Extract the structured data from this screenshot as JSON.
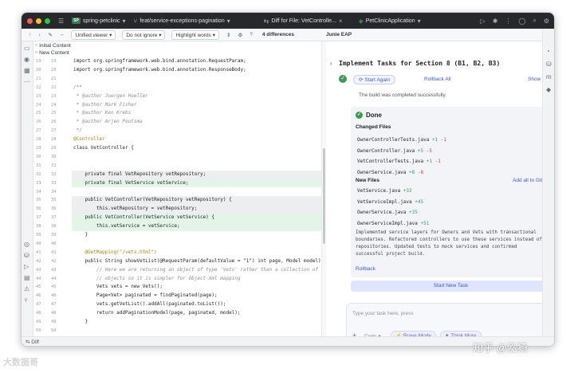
{
  "colors": {
    "titlebar": "#27282c",
    "accent": "#3a5ccc",
    "success": "#3e9b53",
    "diff_added": "#c8ecce",
    "diff_removed": "#edeef0"
  },
  "titlebar": {
    "project": "spring-petclinic",
    "project_badge": "SP",
    "branch": "feat/service-exceptions-pagination",
    "diff_tab": "Diff for File: VetControlle...",
    "run_config": "PetClinicApplication"
  },
  "toolbar": {
    "viewer": "Unified viewer",
    "ignore": "Do not ignore",
    "highlight": "Highlight words",
    "differences": "4 differences",
    "junie_header": "Junie EAP"
  },
  "changes": {
    "initial": "Initial Content",
    "new": "New Content"
  },
  "gutter": [
    {
      "a": "19",
      "b": "19"
    },
    {
      "a": "20",
      "b": "20"
    },
    {
      "a": "21",
      "b": "21"
    },
    {
      "a": "22",
      "b": "22"
    },
    {
      "a": "23",
      "b": "23"
    },
    {
      "a": "24",
      "b": "24"
    },
    {
      "a": "25",
      "b": "25"
    },
    {
      "a": "26",
      "b": "26"
    },
    {
      "a": "27",
      "b": "27"
    },
    {
      "a": "28",
      "b": "28"
    },
    {
      "a": "29",
      "b": "29"
    },
    {
      "a": "30",
      "b": "30"
    },
    {
      "a": "31",
      "b": "31"
    },
    {
      "a": "32",
      "b": "32"
    },
    {
      "a": "33",
      "b": "33"
    },
    {
      "a": "34",
      "b": "34"
    },
    {
      "a": "35",
      "b": "35"
    },
    {
      "a": "36",
      "b": "36"
    },
    {
      "a": "37",
      "b": "37"
    },
    {
      "a": "38",
      "b": "38"
    },
    {
      "a": "39",
      "b": "39"
    },
    {
      "a": "40",
      "b": "40"
    },
    {
      "a": "41",
      "b": "41"
    },
    {
      "a": "42",
      "b": "42"
    },
    {
      "a": "43",
      "b": "43"
    },
    {
      "a": "44",
      "b": "44"
    },
    {
      "a": "45",
      "b": "45"
    },
    {
      "a": "46",
      "b": "46"
    },
    {
      "a": "47",
      "b": "47"
    },
    {
      "a": "48",
      "b": "48"
    },
    {
      "a": "49",
      "b": "49"
    },
    {
      "a": "50",
      "b": "50"
    },
    {
      "a": "51",
      "b": "51"
    },
    {
      "a": "52",
      "b": "52"
    },
    {
      "a": "53",
      "b": "53"
    },
    {
      "a": "54",
      "b": "54"
    },
    {
      "a": "55",
      "b": "55"
    }
  ],
  "code": [
    "import org.springframework.web.bind.annotation.RequestParam;",
    "import org.springframework.web.bind.annotation.ResponseBody;",
    "",
    "/**",
    " * @author Juergen Hoeller",
    " * @author Mark Fisher",
    " * @author Ken Krebs",
    " * @author Arjen Poutsma",
    " */",
    "@Controller",
    "class VetController {",
    "",
    "",
    "    private final VetRepository vetRepository;",
    "    private final VetService vetService;",
    "",
    "    public VetController(VetRepository vetRepository) {",
    "        this.vetRepository = vetRepository;",
    "    public VetController(VetService vetService) {",
    "        this.vetService = vetService;",
    "    }",
    "",
    "    @GetMapping(\"/vets.html\")",
    "    public String showVetList(@RequestParam(defaultValue = \"1\") int page, Model model) {",
    "        // Here we are returning an object of type 'Vets' rather than a collection of",
    "        // objects so it is simpler for Object-Xml mapping",
    "        Vets vets = new Vets();",
    "        Page<Vet> paginated = findPaginated(page);",
    "        vets.getVetList().addAll(paginated.toList());",
    "        return addPaginationModel(page, paginated, model);",
    "    }",
    "",
    "    private String addPaginationModel(int page, Page<Vet> paginated, Model model) {",
    "        List<Vet> listVets = paginated.getContent();",
    "        model.addAttribute(\"currentPage\", page);"
  ],
  "junie": {
    "title": "Implement Tasks for Section 8 (B1, B2, B3)",
    "start_again": "Start Again",
    "rollback_all": "Rollback All",
    "show_plan": "Show Plan",
    "build_status": "The build was completed successfully.",
    "done_label": "Done",
    "changed_files_label": "Changed Files",
    "changed_files": [
      {
        "name": "OwnerControllerTests.java",
        "plus": "+1",
        "minus": "-1"
      },
      {
        "name": "OwnerController.java",
        "plus": "+5",
        "minus": "-5"
      },
      {
        "name": "VetControllerTests.java",
        "plus": "+1",
        "minus": "-1"
      },
      {
        "name": "OwnerService.java",
        "plus": "+8",
        "minus": "-8"
      }
    ],
    "new_files_label": "New Files",
    "add_all": "Add all to Git",
    "new_files": [
      {
        "name": "VetService.java",
        "plus": "+32"
      },
      {
        "name": "VetServiceImpl.java",
        "plus": "+45"
      },
      {
        "name": "OwnerService.java",
        "plus": "+35"
      },
      {
        "name": "OwnerServiceImpl.java",
        "plus": "+51"
      }
    ],
    "summary": "Implemented service layers for Owners and Vets with transactional boundaries. Refactored controllers to use these services instead of repositories. Updated tests to mock services and confirmed successful project build.",
    "rollback": "Rollback",
    "new_task": "Start New Task",
    "input_placeholder": "Type your task here, press",
    "code_label": "Code",
    "brave_mode": "Brave Mode",
    "think_more": "Think More"
  },
  "status": {
    "diff": "Diff"
  },
  "watermarks": {
    "left": "大数据哥",
    "right": "知乎 @泓猗"
  }
}
